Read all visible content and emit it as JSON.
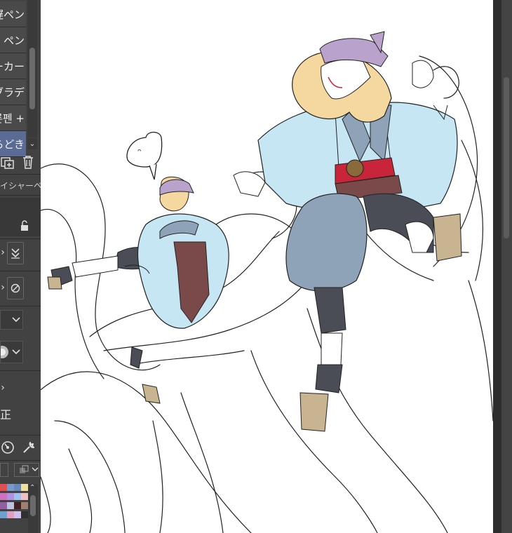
{
  "brush_list": {
    "items": [
      {
        "label": "遅ペン",
        "selected": false
      },
      {
        "label": "ペン",
        "selected": false
      },
      {
        "label": "ーカー",
        "selected": false
      },
      {
        "label": "ブラデ",
        "selected": false
      },
      {
        "label": "른펜 +",
        "selected": false
      },
      {
        "label": "らどき",
        "selected": true
      }
    ],
    "dropdown_icon": "chevron-down-icon"
  },
  "tool_property": {
    "title": "イシャーベ",
    "lock_icon": "lock-icon",
    "stabilization_label": "正",
    "stepper_icons": [
      "chevron-up-down-icon",
      "double-chevron-down-icon",
      "no-entry-icon"
    ]
  },
  "bottom_tools": {
    "icons": [
      "settings-dial-icon",
      "wrench-icon",
      "layer-icon"
    ]
  },
  "palette": {
    "colors": [
      "#e05050",
      "#7799cc",
      "#6688bb",
      "#f0e0a0",
      "#d070c0",
      "#b090e0",
      "#a0c0f0",
      "#f0c0c0",
      "#9060a0",
      "#c0c0e0",
      "#402020",
      "#a08070",
      "#70a0d0",
      "#e0a0c0",
      "#d0c0f0",
      "#303030"
    ]
  },
  "canvas": {
    "speech_bubble_text": "ᵔ",
    "colors": {
      "bandana": "#b9a3cc",
      "robe": "#c7e6f3",
      "robe_shadow": "#8ea3b8",
      "hair": "#f5d8a0",
      "belt": "#c8243a",
      "sash": "#7a4a4a",
      "pants": "#4a4d55",
      "sandal": "#c8b490"
    }
  }
}
